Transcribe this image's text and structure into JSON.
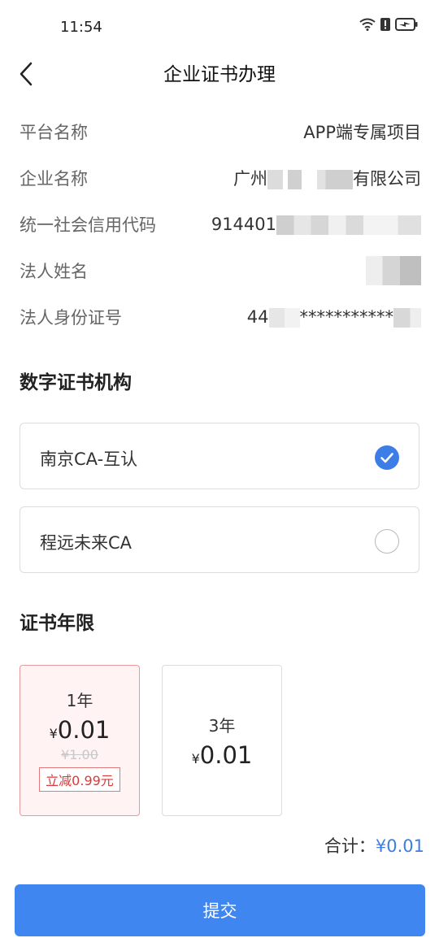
{
  "status": {
    "time": "11:54",
    "icons": [
      "wifi-icon",
      "alert-icon",
      "battery-charging-icon"
    ]
  },
  "header": {
    "title": "企业证书办理",
    "back_icon": "chevron-left-icon"
  },
  "info": {
    "platform_label": "平台名称",
    "platform_value": "APP端专属项目",
    "company_label": "企业名称",
    "company_prefix": "广州",
    "company_suffix": "有限公司",
    "credit_label": "统一社会信用代码",
    "credit_value": "914401",
    "legal_name_label": "法人姓名",
    "legal_id_label": "法人身份证号",
    "legal_id_prefix": "44",
    "legal_id_mask": "***********"
  },
  "ca_section": {
    "title": "数字证书机构",
    "options": [
      {
        "label": "南京CA-互认",
        "selected": true
      },
      {
        "label": "程远未来CA",
        "selected": false
      }
    ]
  },
  "years_section": {
    "title": "证书年限",
    "options": [
      {
        "term": "1年",
        "currency": "¥",
        "price": "0.01",
        "original": "¥1.00",
        "badge": "立减0.99元",
        "selected": true
      },
      {
        "term": "3年",
        "currency": "¥",
        "price": "0.01",
        "selected": false
      }
    ]
  },
  "total": {
    "label": "合计：",
    "value": "¥0.01"
  },
  "submit": {
    "label": "提交"
  },
  "colors": {
    "accent": "#3f86f0",
    "selected_border": "#e89a9a",
    "discount_red": "#d93a3a"
  }
}
